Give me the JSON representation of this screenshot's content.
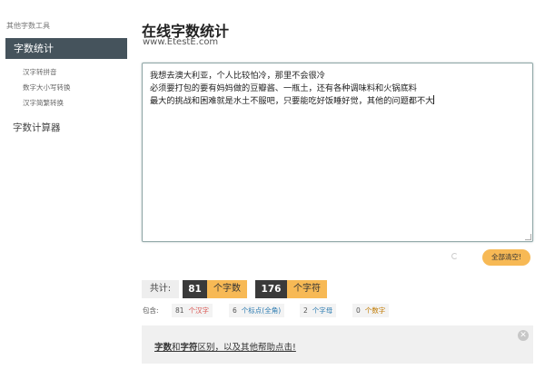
{
  "sidebar": {
    "heading": "其他字数工具",
    "active_item": "字数统计",
    "sub_items": [
      "汉字转拼音",
      "数字大小写转换",
      "汉字简繁转换"
    ],
    "other_item": "字数计算器"
  },
  "main": {
    "title": "在线字数统计",
    "url": "www.EtestE.com"
  },
  "editor": {
    "lines": [
      "我想去澳大利亚，个人比较怕冷，那里不会很冷",
      "必须要打包的要有妈妈做的豆瓣酱、一瓶土，还有各种调味料和火锅底料",
      "最大的挑战和困难就是水土不服吧，只要能吃好饭睡好觉，其他的问题都不大"
    ]
  },
  "clear_button": "全部清空!",
  "stats": {
    "total_label": "共计:",
    "char_count": "81",
    "char_unit": "个字数",
    "symbol_count": "176",
    "symbol_unit": "个字符"
  },
  "breakdown": {
    "label": "包含:",
    "hanzi_count": "81",
    "hanzi_label": "个汉字",
    "punct_count": "6",
    "punct_label": "个标点(全角)",
    "letter_count": "2",
    "letter_label": "个字母",
    "digit_count": "0",
    "digit_label": "个数字"
  },
  "help": {
    "word1": "字数",
    "and": "和",
    "word2": "字符",
    "rest": "区别，以及其他帮助点击!"
  },
  "colors": {
    "sidebar_active": "#45535c",
    "accent_orange": "#f7b955",
    "dark_badge": "#3a3a3a"
  }
}
